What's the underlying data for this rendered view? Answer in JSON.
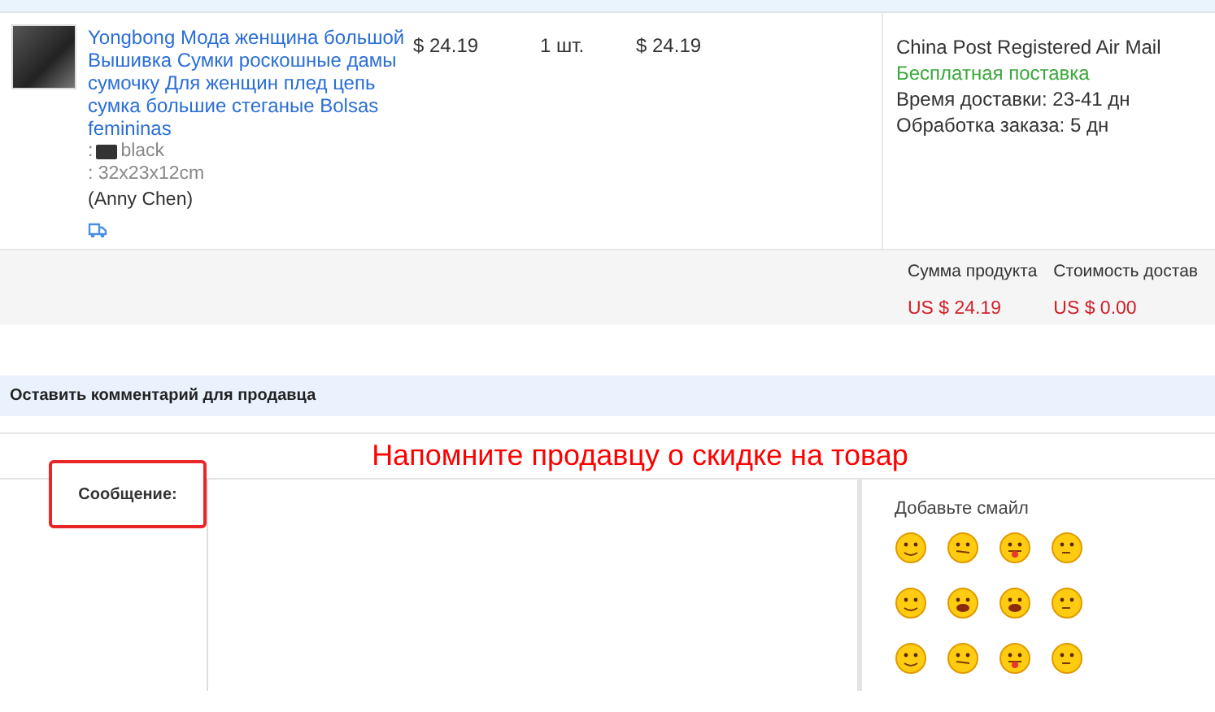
{
  "product": {
    "title": "Yongbong Мода женщина большой Вышивка Сумки роскошные дамы сумочку Для женщин плед цепь сумка большие стеганые Bolsas femininas",
    "color_label": ": ",
    "color_name": "black",
    "size": ": 32x23x12cm",
    "seller": "(Anny Chen)",
    "price": "$ 24.19",
    "quantity": "1 шт.",
    "total": "$ 24.19"
  },
  "shipping": {
    "method": "China Post Registered Air Mail",
    "free": "Бесплатная поставка",
    "delivery_label": "Время доставки:",
    "delivery": "23-41 дн",
    "processing_label": "Обработка заказа:",
    "processing": "5 дн"
  },
  "summary": [
    {
      "label": "Сумма продукта",
      "value": "US $ 24.19"
    },
    {
      "label": "Стоимость достав",
      "value": "US $ 0.00"
    }
  ],
  "comment": {
    "header": "Оставить комментарий для продавца",
    "hint": "Напомните продавцу о скидке на товар",
    "label": "Сообщение:",
    "emoji_title": "Добавьте смайл"
  },
  "emojis": [
    {
      "kind": "smile"
    },
    {
      "kind": "wink"
    },
    {
      "kind": "tongue"
    },
    {
      "kind": "think"
    },
    {
      "kind": "smile"
    },
    {
      "kind": "laugh"
    },
    {
      "kind": "laugh"
    },
    {
      "kind": "think"
    },
    {
      "kind": "smile"
    },
    {
      "kind": "wink"
    },
    {
      "kind": "tongue"
    },
    {
      "kind": "think"
    }
  ]
}
